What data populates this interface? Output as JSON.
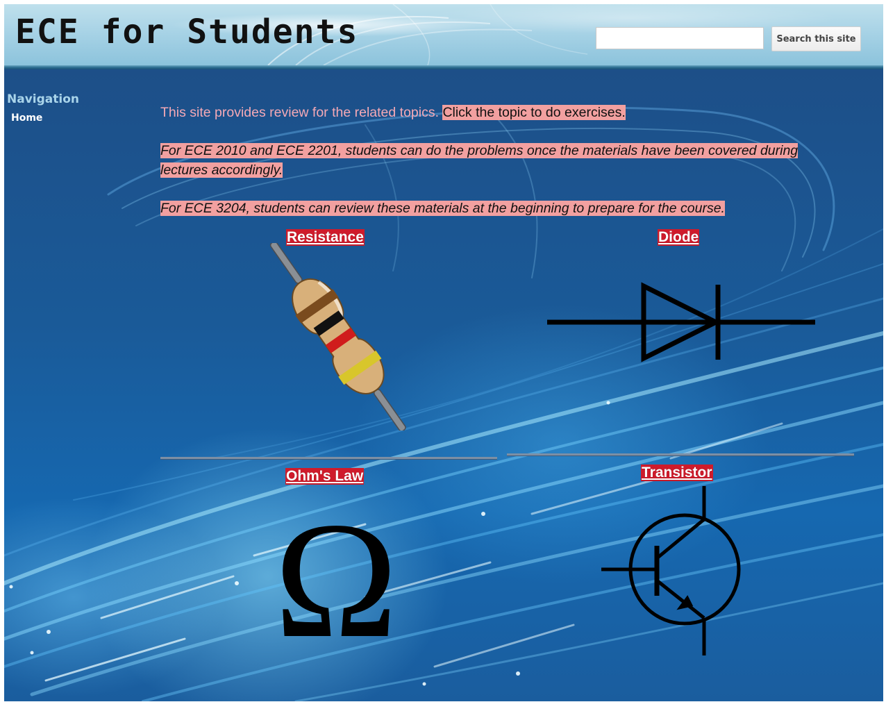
{
  "header": {
    "site_title": "ECE for Students",
    "search_placeholder": "",
    "search_value": "",
    "search_button_label": "Search this site"
  },
  "navigation": {
    "title": "Navigation",
    "items": [
      {
        "label": "Home"
      }
    ]
  },
  "intro": {
    "line1_plain": "This site provides review for the related topics.",
    "line1_highlight": "Click the topic to do exercises.",
    "line2": "For ECE 2010 and ECE 2201, students can do the problems once the materials have been covered during lectures accordingly.",
    "line3": "For ECE 3204, students can review these materials at the beginning to prepare for the course."
  },
  "topics": [
    {
      "label": "Resistance",
      "icon": "resistor-icon"
    },
    {
      "label": "Diode",
      "icon": "diode-symbol-icon"
    },
    {
      "label": "Ohm's Law",
      "icon": "omega-icon"
    },
    {
      "label": "Transistor",
      "icon": "transistor-symbol-icon"
    }
  ],
  "colors": {
    "header_bg": "#a8d3e6",
    "main_bg": "#1a5a98",
    "topic_link_bg": "#cf1b2b",
    "text_highlight": "#f2a0a0",
    "nav_title": "#a9d4ea"
  }
}
